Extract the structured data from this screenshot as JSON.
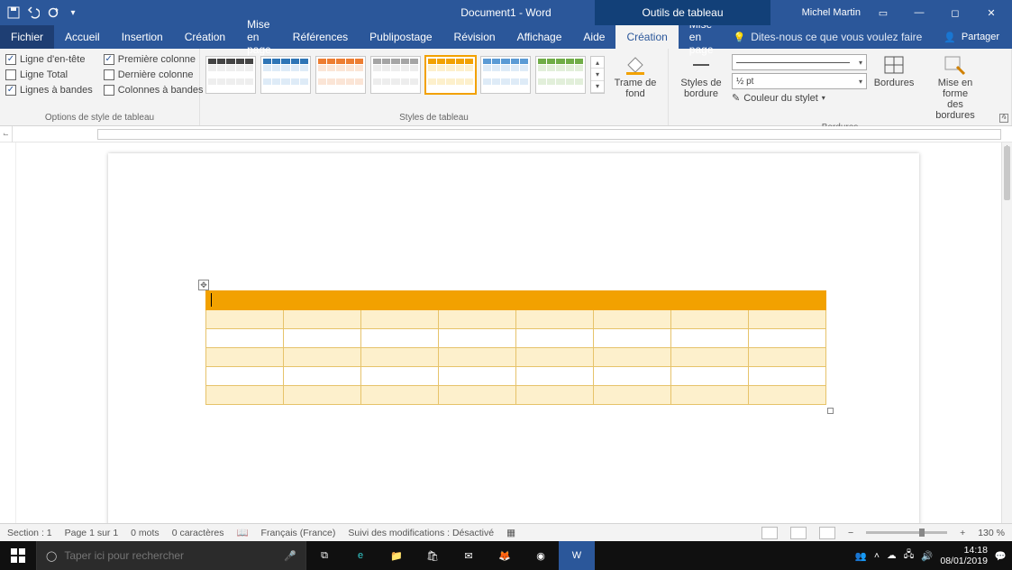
{
  "title": "Document1 - Word",
  "context_title": "Outils de tableau",
  "user": "Michel Martin",
  "tabs": {
    "file": "Fichier",
    "home": "Accueil",
    "insert": "Insertion",
    "design": "Création",
    "layout": "Mise en page",
    "references": "Références",
    "mailings": "Publipostage",
    "review": "Révision",
    "view": "Affichage",
    "help": "Aide",
    "tbl_design": "Création",
    "tbl_layout": "Mise en page"
  },
  "tellme_placeholder": "Dites-nous ce que vous voulez faire",
  "share": "Partager",
  "ribbon": {
    "groups": {
      "options": "Options de style de tableau",
      "styles": "Styles de tableau",
      "borders": "Bordures"
    },
    "opts": {
      "header_row": "Ligne d'en-tête",
      "total_row": "Ligne Total",
      "banded_rows": "Lignes à bandes",
      "first_col": "Première colonne",
      "last_col": "Dernière colonne",
      "banded_cols": "Colonnes à bandes"
    },
    "shading": "Trame de\nfond",
    "border_styles": "Styles de\nbordure",
    "pen_weight": "½ pt",
    "pen_color": "Couleur du stylet",
    "borders_btn": "Bordures",
    "border_painter": "Mise en forme\ndes bordures"
  },
  "status": {
    "section": "Section : 1",
    "page": "Page 1 sur 1",
    "words": "0 mots",
    "chars": "0 caractères",
    "lang": "Français (France)",
    "track": "Suivi des modifications : Désactivé",
    "zoom": "130 %"
  },
  "taskbar": {
    "search_placeholder": "Taper ici pour rechercher",
    "time": "14:18",
    "date": "08/01/2019"
  }
}
